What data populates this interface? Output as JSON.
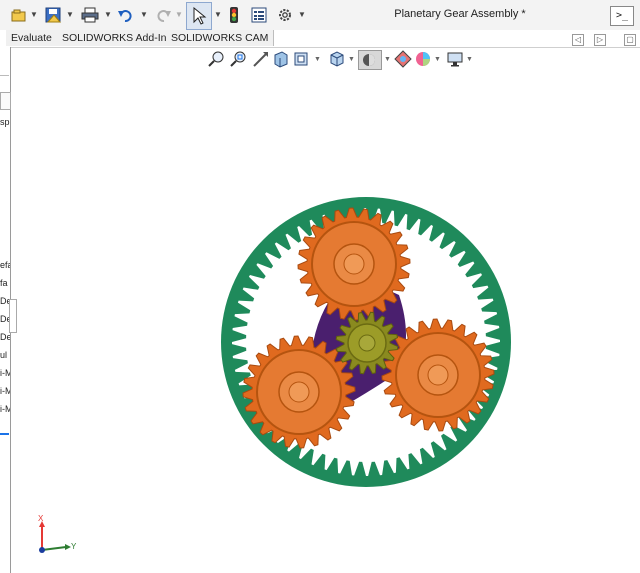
{
  "window": {
    "title": "Planetary Gear Assembly *"
  },
  "tabs": [
    {
      "label": "Evaluate"
    },
    {
      "label": "SOLIDWORKS Add-Ins"
    },
    {
      "label": "SOLIDWORKS CAM"
    }
  ],
  "left_panel": {
    "fragments": [
      "sp",
      "efa",
      "fa",
      "De",
      "De",
      "De",
      "ul",
      "i-M",
      "i-M",
      "i-M"
    ]
  },
  "triad": {
    "x_label": "Y",
    "y_label": "X"
  },
  "colors": {
    "ring_gear": "#1f8a5b",
    "planet_gear": "#e06a1f",
    "sun_gear": "#8a8a1f",
    "carrier": "#4a1f6e",
    "accent_blue": "#1a73e8"
  },
  "icons": {
    "top_toolbar": [
      "open-icon",
      "save-icon",
      "print-icon",
      "undo-icon",
      "redo-icon",
      "select-icon",
      "traffic-light-icon",
      "file-properties-icon",
      "options-gear-icon"
    ],
    "heads_up": [
      "zoom-to-fit-icon",
      "zoom-area-icon",
      "previous-view-icon",
      "section-view-icon",
      "dynamic-annotation-icon",
      "view-orientation-icon",
      "display-style-icon",
      "hide-show-icon",
      "edit-appearance-icon",
      "apply-scene-icon",
      "view-settings-icon"
    ]
  }
}
